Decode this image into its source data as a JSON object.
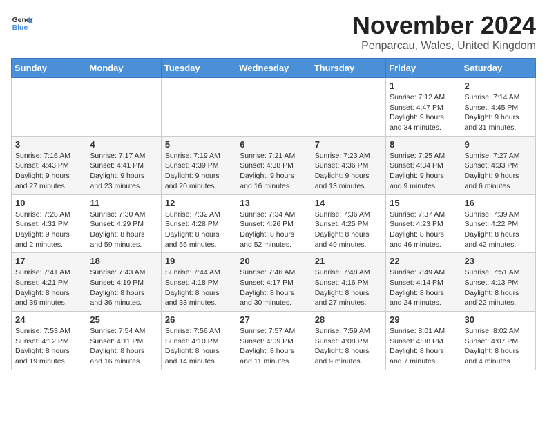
{
  "logo": {
    "general": "General",
    "blue": "Blue"
  },
  "title": "November 2024",
  "subtitle": "Penparcau, Wales, United Kingdom",
  "days_of_week": [
    "Sunday",
    "Monday",
    "Tuesday",
    "Wednesday",
    "Thursday",
    "Friday",
    "Saturday"
  ],
  "weeks": [
    [
      {
        "day": "",
        "info": ""
      },
      {
        "day": "",
        "info": ""
      },
      {
        "day": "",
        "info": ""
      },
      {
        "day": "",
        "info": ""
      },
      {
        "day": "",
        "info": ""
      },
      {
        "day": "1",
        "info": "Sunrise: 7:12 AM\nSunset: 4:47 PM\nDaylight: 9 hours\nand 34 minutes."
      },
      {
        "day": "2",
        "info": "Sunrise: 7:14 AM\nSunset: 4:45 PM\nDaylight: 9 hours\nand 31 minutes."
      }
    ],
    [
      {
        "day": "3",
        "info": "Sunrise: 7:16 AM\nSunset: 4:43 PM\nDaylight: 9 hours\nand 27 minutes."
      },
      {
        "day": "4",
        "info": "Sunrise: 7:17 AM\nSunset: 4:41 PM\nDaylight: 9 hours\nand 23 minutes."
      },
      {
        "day": "5",
        "info": "Sunrise: 7:19 AM\nSunset: 4:39 PM\nDaylight: 9 hours\nand 20 minutes."
      },
      {
        "day": "6",
        "info": "Sunrise: 7:21 AM\nSunset: 4:38 PM\nDaylight: 9 hours\nand 16 minutes."
      },
      {
        "day": "7",
        "info": "Sunrise: 7:23 AM\nSunset: 4:36 PM\nDaylight: 9 hours\nand 13 minutes."
      },
      {
        "day": "8",
        "info": "Sunrise: 7:25 AM\nSunset: 4:34 PM\nDaylight: 9 hours\nand 9 minutes."
      },
      {
        "day": "9",
        "info": "Sunrise: 7:27 AM\nSunset: 4:33 PM\nDaylight: 9 hours\nand 6 minutes."
      }
    ],
    [
      {
        "day": "10",
        "info": "Sunrise: 7:28 AM\nSunset: 4:31 PM\nDaylight: 9 hours\nand 2 minutes."
      },
      {
        "day": "11",
        "info": "Sunrise: 7:30 AM\nSunset: 4:29 PM\nDaylight: 8 hours\nand 59 minutes."
      },
      {
        "day": "12",
        "info": "Sunrise: 7:32 AM\nSunset: 4:28 PM\nDaylight: 8 hours\nand 55 minutes."
      },
      {
        "day": "13",
        "info": "Sunrise: 7:34 AM\nSunset: 4:26 PM\nDaylight: 8 hours\nand 52 minutes."
      },
      {
        "day": "14",
        "info": "Sunrise: 7:36 AM\nSunset: 4:25 PM\nDaylight: 8 hours\nand 49 minutes."
      },
      {
        "day": "15",
        "info": "Sunrise: 7:37 AM\nSunset: 4:23 PM\nDaylight: 8 hours\nand 46 minutes."
      },
      {
        "day": "16",
        "info": "Sunrise: 7:39 AM\nSunset: 4:22 PM\nDaylight: 8 hours\nand 42 minutes."
      }
    ],
    [
      {
        "day": "17",
        "info": "Sunrise: 7:41 AM\nSunset: 4:21 PM\nDaylight: 8 hours\nand 39 minutes."
      },
      {
        "day": "18",
        "info": "Sunrise: 7:43 AM\nSunset: 4:19 PM\nDaylight: 8 hours\nand 36 minutes."
      },
      {
        "day": "19",
        "info": "Sunrise: 7:44 AM\nSunset: 4:18 PM\nDaylight: 8 hours\nand 33 minutes."
      },
      {
        "day": "20",
        "info": "Sunrise: 7:46 AM\nSunset: 4:17 PM\nDaylight: 8 hours\nand 30 minutes."
      },
      {
        "day": "21",
        "info": "Sunrise: 7:48 AM\nSunset: 4:16 PM\nDaylight: 8 hours\nand 27 minutes."
      },
      {
        "day": "22",
        "info": "Sunrise: 7:49 AM\nSunset: 4:14 PM\nDaylight: 8 hours\nand 24 minutes."
      },
      {
        "day": "23",
        "info": "Sunrise: 7:51 AM\nSunset: 4:13 PM\nDaylight: 8 hours\nand 22 minutes."
      }
    ],
    [
      {
        "day": "24",
        "info": "Sunrise: 7:53 AM\nSunset: 4:12 PM\nDaylight: 8 hours\nand 19 minutes."
      },
      {
        "day": "25",
        "info": "Sunrise: 7:54 AM\nSunset: 4:11 PM\nDaylight: 8 hours\nand 16 minutes."
      },
      {
        "day": "26",
        "info": "Sunrise: 7:56 AM\nSunset: 4:10 PM\nDaylight: 8 hours\nand 14 minutes."
      },
      {
        "day": "27",
        "info": "Sunrise: 7:57 AM\nSunset: 4:09 PM\nDaylight: 8 hours\nand 11 minutes."
      },
      {
        "day": "28",
        "info": "Sunrise: 7:59 AM\nSunset: 4:08 PM\nDaylight: 8 hours\nand 9 minutes."
      },
      {
        "day": "29",
        "info": "Sunrise: 8:01 AM\nSunset: 4:08 PM\nDaylight: 8 hours\nand 7 minutes."
      },
      {
        "day": "30",
        "info": "Sunrise: 8:02 AM\nSunset: 4:07 PM\nDaylight: 8 hours\nand 4 minutes."
      }
    ]
  ]
}
